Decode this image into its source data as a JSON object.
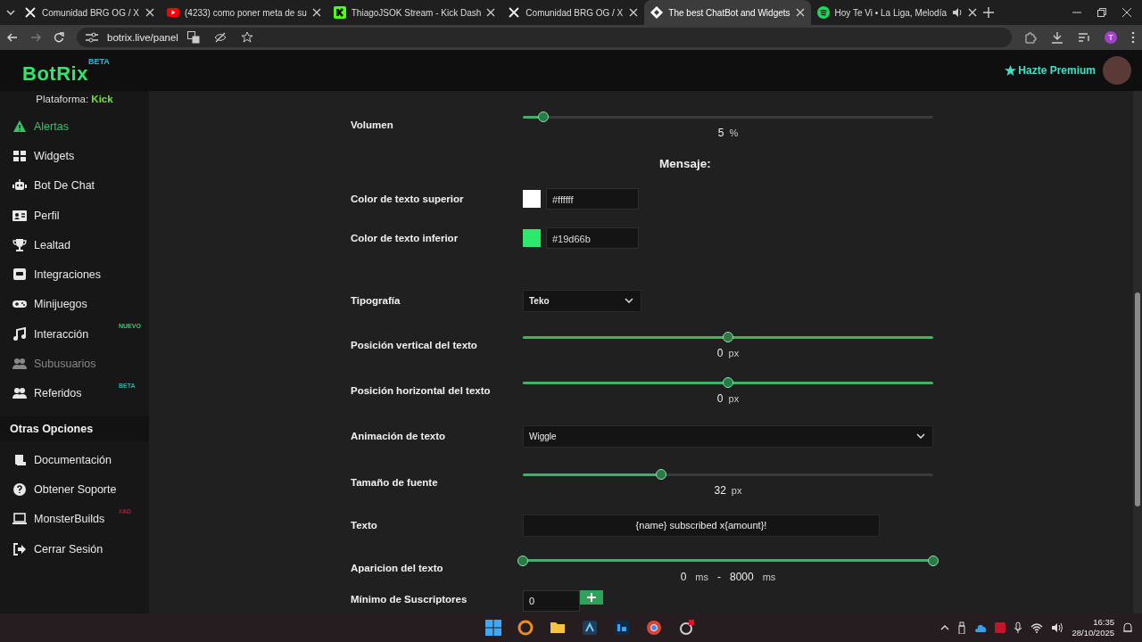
{
  "browser": {
    "tabs": [
      {
        "title": "Comunidad BRG OG / X",
        "selected": false
      },
      {
        "title": "(4233) como poner meta de su",
        "selected": false
      },
      {
        "title": "ThiagoJSOK Stream - Kick Dash",
        "selected": false
      },
      {
        "title": "Comunidad BRG OG / X",
        "selected": false
      },
      {
        "title": "The best ChatBot and Widgets",
        "selected": true
      },
      {
        "title": "Hoy Te Vi • La Liga, Melodía",
        "selected": false
      }
    ],
    "address": "botrix.live/panel",
    "profile_initial": "T"
  },
  "header": {
    "logo": "BotRix",
    "logo_badge": "BETA",
    "premium": "Hazte Premium"
  },
  "sidebar": {
    "platform_label": "Plataforma:",
    "platform": "Kick",
    "items": [
      {
        "label": "Alertas",
        "selected": true,
        "disabled": false
      },
      {
        "label": "Widgets",
        "selected": false,
        "disabled": false
      },
      {
        "label": "Bot De Chat",
        "selected": false,
        "disabled": false
      },
      {
        "label": "Perfil",
        "selected": false,
        "disabled": false
      },
      {
        "label": "Lealtad",
        "selected": false,
        "disabled": false
      },
      {
        "label": "Integraciones",
        "selected": false,
        "disabled": false
      },
      {
        "label": "Minijuegos",
        "selected": false,
        "disabled": false
      },
      {
        "label": "Interacción",
        "selected": false,
        "disabled": false,
        "badge": "NUEVO",
        "color": "#2ecc71"
      },
      {
        "label": "Subusuarios",
        "selected": false,
        "disabled": true
      },
      {
        "label": "Referidos",
        "selected": false,
        "disabled": false,
        "badge": "BETA",
        "color": "#3aa8a8"
      }
    ],
    "section": "Otras Opciones",
    "other_items": [
      {
        "label": "Documentación"
      },
      {
        "label": "Obtener Soporte"
      },
      {
        "label": "MonsterBuilds",
        "badge": "#AD",
        "color": "#a3213f"
      },
      {
        "label": "Cerrar Sesión"
      }
    ]
  },
  "form": [
    {
      "kind": "slider",
      "label": "Volumen",
      "level": 0.05,
      "full_track": false,
      "value": "5",
      "unit": "%"
    },
    {
      "kind": "heading",
      "label": "Mensaje:"
    },
    {
      "kind": "color",
      "label": "Color de texto superior",
      "color": "#ffffff",
      "value": "#ffffff"
    },
    {
      "kind": "color",
      "label": "Color de texto inferior",
      "color": "#2ee86b",
      "value": "#19d66b"
    },
    {
      "kind": "select",
      "label": "Tipografía",
      "value": "Teko",
      "wide": false
    },
    {
      "kind": "slider",
      "label": "Posición vertical del texto",
      "level": 0.5,
      "full_track": true,
      "value": "0",
      "unit": "px"
    },
    {
      "kind": "slider",
      "label": "Posición horizontal del texto",
      "level": 0.5,
      "full_track": true,
      "value": "0",
      "unit": "px"
    },
    {
      "kind": "select",
      "label": "Animación de texto",
      "value": "Wiggle",
      "wide": true
    },
    {
      "kind": "slider",
      "label": "Tamaño de fuente",
      "level": 0.337,
      "full_track": false,
      "value": "32",
      "unit": "px"
    },
    {
      "kind": "text",
      "label": "Texto",
      "value": "{name} subscribed x{amount}!"
    },
    {
      "kind": "range",
      "label": "Aparicion del texto",
      "thumbs": [
        {
          "level": 0
        },
        {
          "level": 1
        }
      ],
      "from": "0",
      "to": "8000",
      "unit": "ms",
      "to_unit": "ms",
      "separator": "-"
    },
    {
      "kind": "number",
      "label": "Mínimo de Suscriptores",
      "value": "0"
    }
  ],
  "taskbar": {
    "time": "16:35",
    "date": "28/10/2025"
  }
}
